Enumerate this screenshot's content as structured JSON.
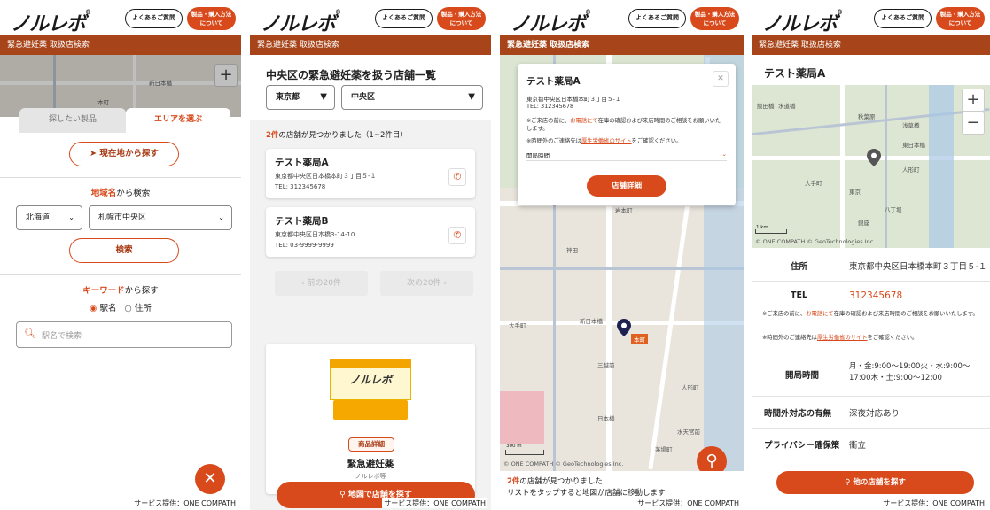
{
  "common": {
    "logo": "ノルレボ",
    "faq": "よくあるご質問",
    "buy_l1": "製品・購入方法",
    "buy_l2": "について",
    "service": "サービス提供：ONE COMPATH",
    "map_credit": "© ONE COMPATH © GeoTechnologies Inc.",
    "zoom_in": "+",
    "zoom_out": "−"
  },
  "p1": {
    "subheader": "緊急避妊薬 取扱店検索",
    "tab_product": "探したい製品",
    "tab_area": "エリアを選ぶ",
    "current_location": "現在地から探す",
    "region_title_strong": "地域名",
    "region_title_rest": "から検索",
    "pref": "北海道",
    "city": "札幌市中央区",
    "search": "検索",
    "keyword_title_strong": "キーワード",
    "keyword_title_rest": "から探す",
    "radio_station": "駅名",
    "radio_address": "住所",
    "keyword_placeholder": "駅名で検索",
    "map_labels": [
      "新日本橋",
      "本町"
    ]
  },
  "p2": {
    "subheader": "緊急避妊薬 取扱店検索",
    "title": "中央区の緊急避妊薬を扱う店舗一覧",
    "pref": "東京都",
    "city": "中央区",
    "count_num": "2件",
    "count_rest": "の店舗が見つかりました（1~2件目）",
    "stores": [
      {
        "name": "テスト薬局A",
        "address": "東京都中央区日本橋本町３丁目５-１",
        "tel": "TEL: 312345678"
      },
      {
        "name": "テスト薬局B",
        "address": "東京都中央区日本橋3-14-10",
        "tel": "TEL: 03-9999-9999"
      }
    ],
    "prev": "前の20件",
    "next": "次の20件",
    "product_badge": "商品詳細",
    "product_name": "緊急避妊薬",
    "product_sub": "ノルレボ等",
    "map_button": "地図で店舗を探す"
  },
  "p3": {
    "subheader": "緊急避妊薬 取扱店検索",
    "popup_title": "テスト薬局A",
    "popup_address": "東京都中央区日本橋本町３丁目５-１",
    "popup_tel": "TEL: 312345678",
    "note1_a": "※ご来店の前に、",
    "note1_link": "お電話にて",
    "note1_b": "在庫の確認および来店時間のご相談をお願いいたします。",
    "note2_a": "※時間外のご連絡先は",
    "note2_link": "厚生労働省のサイト",
    "note2_b": "をご確認ください。",
    "hours_label": "開局時間",
    "detail_button": "店舗詳細",
    "bottom_count": "2件",
    "bottom_count_rest": "の店舗が見つかりました",
    "bottom_hint": "リストをタップすると地図が店舗に移動します",
    "map_labels": [
      "岩本町",
      "神田",
      "大手町",
      "三越前",
      "日本橋",
      "人形町",
      "水天宮前",
      "茅場町",
      "新日本橋",
      "本町"
    ],
    "scale": "300 m"
  },
  "p4": {
    "subheader": "緊急避妊薬 取扱店検索",
    "title": "テスト薬局A",
    "address_label": "住所",
    "address": "東京都中央区日本橋本町３丁目５-１",
    "tel_label": "TEL",
    "tel": "312345678",
    "note1_a": "※ご来店の前に、",
    "note1_link": "お電話にて",
    "note1_b": "在庫の確認および来店時間のご相談をお願いいたします。",
    "note2_a": "※時間外のご連絡先は",
    "note2_link": "厚生労働省のサイト",
    "note2_b": "をご確認ください。",
    "hours_label": "開局時間",
    "hours": "月・金:9:00～19:00火・水:9:00～17:00木・土:9:00～12:00",
    "after_hours_label": "時間外対応の有無",
    "after_hours": "深夜対応あり",
    "privacy_label": "プライバシー確保策",
    "privacy": "衝立",
    "other_button": "他の店舗を探す",
    "map_labels": [
      "秋葉原",
      "浅草橋",
      "東日本橋",
      "人形町",
      "大手町",
      "東京",
      "八丁堀",
      "銀座",
      "飯田橋",
      "水道橋"
    ],
    "scale": "1 km"
  },
  "colors": {
    "brand": "#d84a1b",
    "subheader": "#a84419",
    "link": "#d84a1b"
  }
}
